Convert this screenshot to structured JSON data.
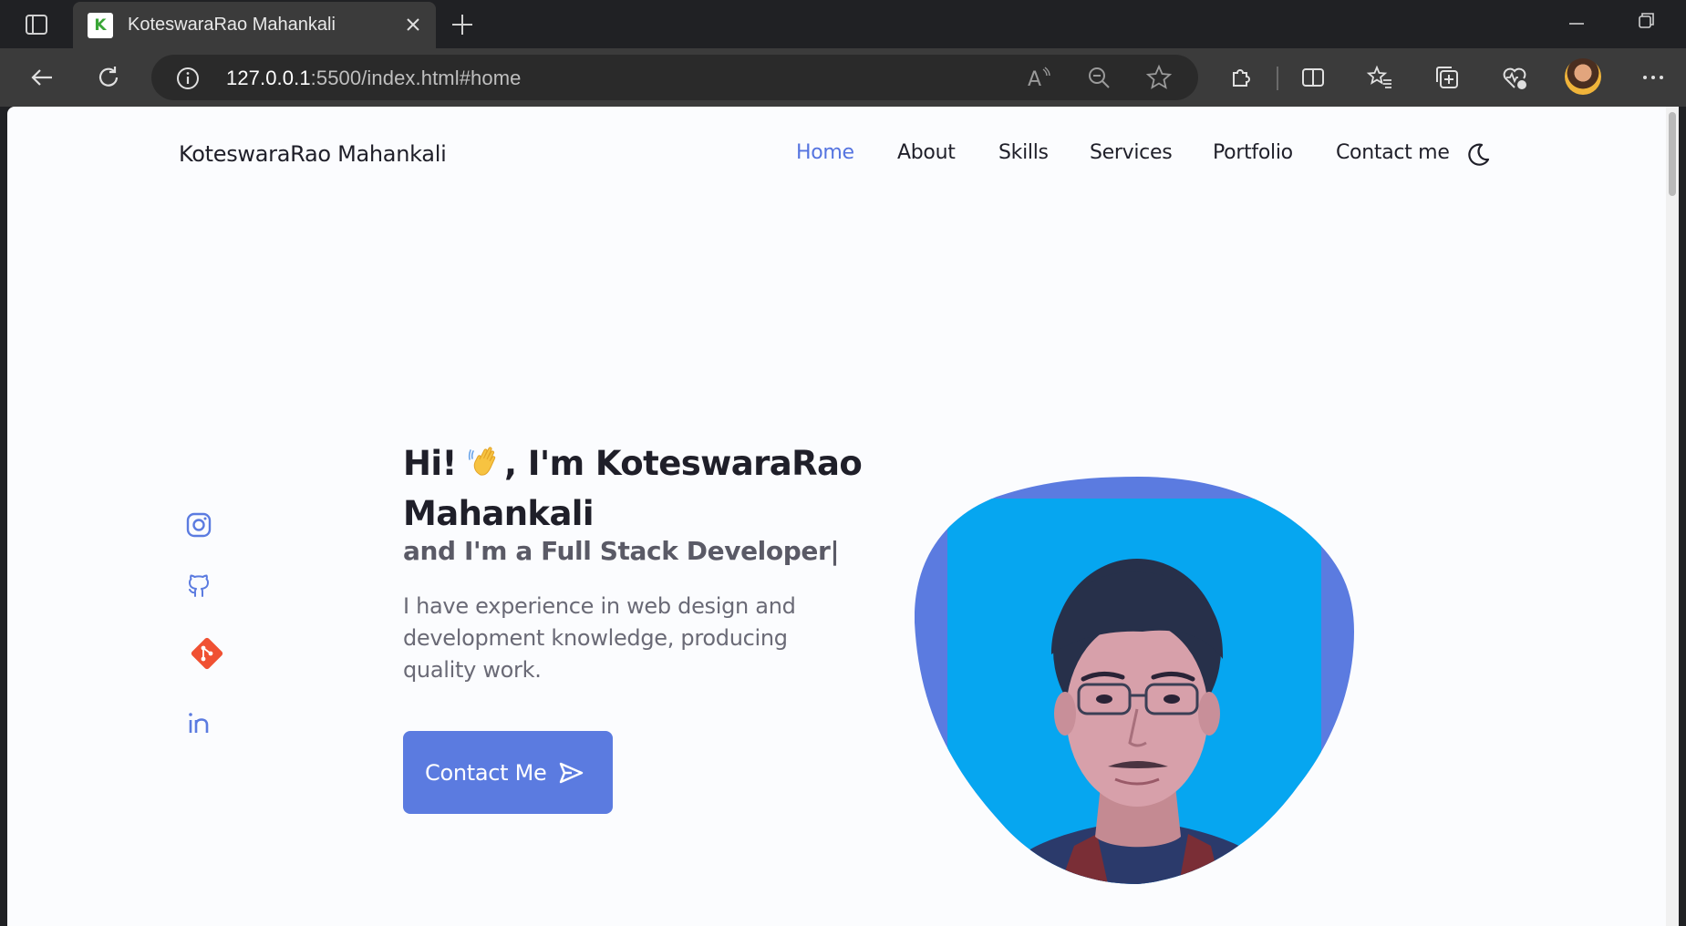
{
  "browser": {
    "tab_title": "KoteswaraRao Mahankali",
    "favicon_letter": "K",
    "url_host": "127.0.0.1",
    "url_rest": ":5500/index.html#home"
  },
  "header": {
    "brand": "KoteswaraRao Mahankali",
    "nav": [
      "Home",
      "About",
      "Skills",
      "Services",
      "Portfolio",
      "Contact me"
    ],
    "active_nav": "Home"
  },
  "hero": {
    "title_before": "Hi! ",
    "title_after": ", I'm KoteswaraRao Mahankali",
    "subtitle": "and I'm a Full Stack Developer|",
    "description": "I have experience in web design and development knowledge, producing quality work.",
    "button_label": "Contact Me"
  },
  "socials": [
    "instagram-icon",
    "github-icon",
    "git-icon",
    "linkedin-icon"
  ],
  "colors": {
    "accent": "#5b7be0",
    "photo_background": "#06a6f0",
    "page_background": "#fbfcfe",
    "text_dark": "#1f1f29"
  }
}
